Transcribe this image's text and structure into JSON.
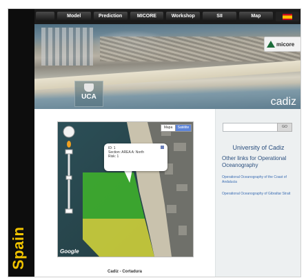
{
  "sidebar": {
    "label": "Spain"
  },
  "nav": {
    "items": [
      {
        "label": ""
      },
      {
        "label": "Model"
      },
      {
        "label": "Prediction"
      },
      {
        "label": "MICORE"
      },
      {
        "label": "Workshop"
      },
      {
        "label": "SII"
      },
      {
        "label": "Map"
      }
    ],
    "flag_icon": "spain-flag-icon"
  },
  "header": {
    "title": "cadiz",
    "partner_logo": "micore",
    "university_logo": "UCA"
  },
  "map": {
    "map_button": "Mapa",
    "satellite_button": "Satélite",
    "popup": {
      "id_line": "ID: 1",
      "section_line": "Section: AREA A: North",
      "risk_line": "Risk: 1"
    },
    "provider": "Google",
    "colors": {
      "zone_green": "#3fb52a",
      "zone_yellow": "#d8d83a"
    }
  },
  "caption": "Cadiz - Cortadura",
  "right": {
    "search_placeholder": "",
    "go_label": "GO",
    "university": "University of Cadiz",
    "links_heading": "Other links for Operational Oceanography",
    "links": [
      "Operational Oceanography of the Coast of Andalucia",
      "Operational Oceanography of Gibraltar Strait"
    ]
  }
}
